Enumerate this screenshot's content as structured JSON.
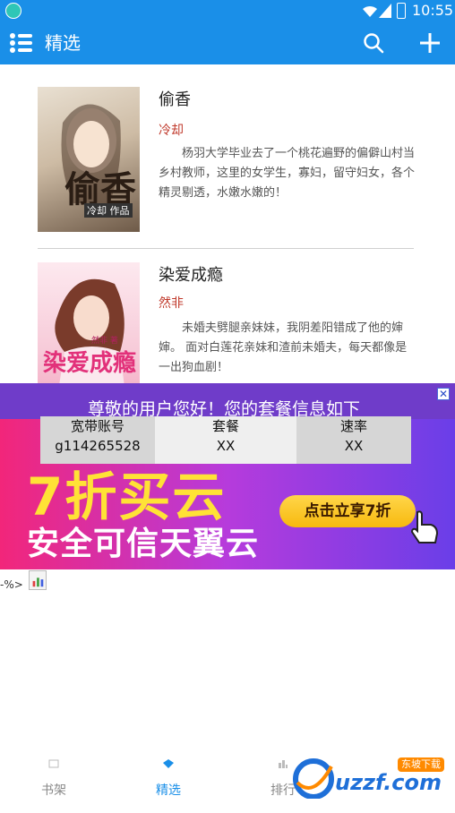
{
  "status_bar": {
    "time": "10:55"
  },
  "app_bar": {
    "title": "精选"
  },
  "books": [
    {
      "title": "偷香",
      "author": "冷却",
      "description": "杨羽大学毕业去了一个桃花遍野的偏僻山村当乡村教师，这里的女学生，寡妇，留守妇女，各个精灵剔透，水嫩水嫩的！",
      "cover_text": "偷香",
      "cover_sub": "冷却 作品"
    },
    {
      "title": "染爱成瘾",
      "author": "然非",
      "description": "未婚夫劈腿亲妹妹，我阴差阳错成了他的婶婶。 面对白莲花亲妹和渣前未婚夫，每天都像是一出狗血剧！",
      "cover_text": "染爱成瘾",
      "cover_sub": "然非 著"
    }
  ],
  "ad": {
    "greeting": "尊敬的用户您好！您的套餐信息如下",
    "close": "✕",
    "table": {
      "headers": [
        "宽带账号",
        "套餐",
        "速率"
      ],
      "values": [
        "g114265528",
        "XX",
        "XX"
      ]
    },
    "headline": "7折买云",
    "subline": "安全可信天翼云",
    "cta": "点击立享7折"
  },
  "debug_text": "-%>",
  "bottom_nav": [
    {
      "label": "书架",
      "active": false
    },
    {
      "label": "精选",
      "active": true
    },
    {
      "label": "排行",
      "active": false
    }
  ],
  "watermark": {
    "text": "uzzf.com",
    "badge": "东坡下载"
  },
  "colors": {
    "primary": "#1a8fe8",
    "author": "#c0392b",
    "ad_yellow": "#ffe236"
  }
}
